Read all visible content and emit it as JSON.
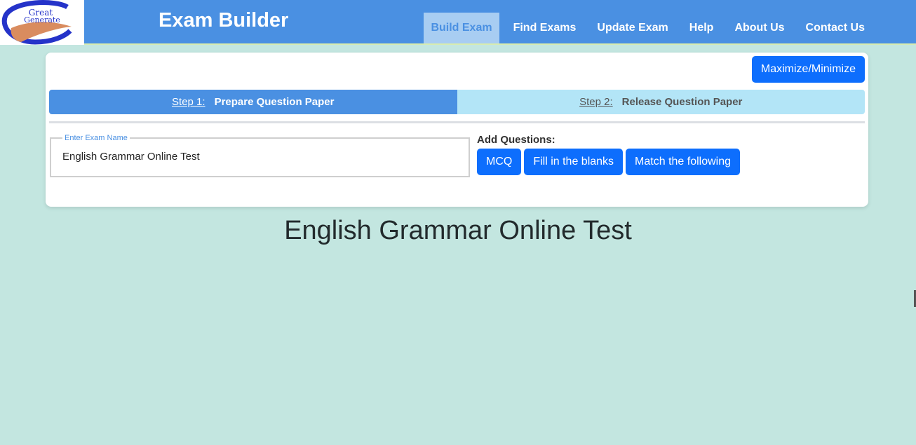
{
  "header": {
    "logo_text_top": "Great",
    "logo_text_bottom": "Generate",
    "title": "Exam Builder",
    "nav": [
      {
        "label": "Build Exam",
        "active": true
      },
      {
        "label": "Find Exams",
        "active": false
      },
      {
        "label": "Update Exam",
        "active": false
      },
      {
        "label": "Help",
        "active": false
      },
      {
        "label": "About Us",
        "active": false
      },
      {
        "label": "Contact Us",
        "active": false
      }
    ]
  },
  "card": {
    "maximize_label": "Maximize/Minimize",
    "steps": [
      {
        "num": "Step 1:",
        "label": "Prepare Question Paper",
        "active": true
      },
      {
        "num": "Step 2:",
        "label": "Release Question Paper",
        "active": false
      }
    ],
    "exam_name_legend": "Enter Exam Name",
    "exam_name_value": "English Grammar Online Test",
    "add_questions_label": "Add Questions:",
    "question_buttons": [
      "MCQ",
      "Fill in the blanks",
      "Match the following"
    ]
  },
  "exam_title": "English Grammar Online Test",
  "colors": {
    "navbar": "#4a90e2",
    "background": "#c3e6e0",
    "primary_button": "#0d6efd",
    "step_active": "#4a90e2",
    "step_inactive": "#b3e5f7"
  }
}
